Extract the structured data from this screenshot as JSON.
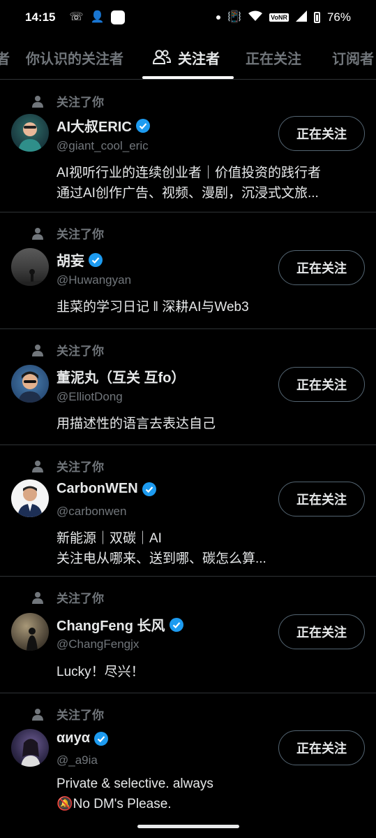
{
  "status_bar": {
    "time": "14:15",
    "battery": "76%",
    "network_badge": "VoNR"
  },
  "tabs": [
    {
      "label": "者"
    },
    {
      "label": "你认识的关注者"
    },
    {
      "label": "关注者"
    },
    {
      "label": "正在关注"
    },
    {
      "label": "订阅者"
    }
  ],
  "follows_you_label": "关注了你",
  "follow_button_label": "正在关注",
  "users": [
    {
      "name": "AI大叔ERIC",
      "handle": "@giant_cool_eric",
      "verified": true,
      "bio": [
        "AI视听行业的连续创业者｜价值投资的践行者",
        "通过AI创作广告、视频、漫剧，沉浸式文旅..."
      ]
    },
    {
      "name": "胡妄",
      "handle": "@Huwangyan",
      "verified": true,
      "bio": [
        "韭菜的学习日记 ‖ 深耕AI与Web3"
      ]
    },
    {
      "name": "董泥丸（互关 互fo）",
      "handle": "@ElliotDong",
      "verified": false,
      "bio": [
        "用描述性的语言去表达自己"
      ]
    },
    {
      "name": "CarbonWEN",
      "handle": "@carbonwen",
      "verified": true,
      "bio": [
        "新能源｜双碳｜AI",
        "关注电从哪来、送到哪、碳怎么算..."
      ]
    },
    {
      "name": "ChangFeng 长风",
      "handle": "@ChangFengjx",
      "verified": true,
      "bio": [
        "Lucky！尽兴！"
      ]
    },
    {
      "name": "αиуα",
      "handle": "@_a9ia",
      "verified": true,
      "bio": [
        "Private & selective. always",
        "🔕No DM's Please."
      ]
    }
  ],
  "colors": {
    "background": "#000000",
    "verified": "#1d9bf0",
    "muted": "#71767b",
    "divider": "#2f3336"
  }
}
